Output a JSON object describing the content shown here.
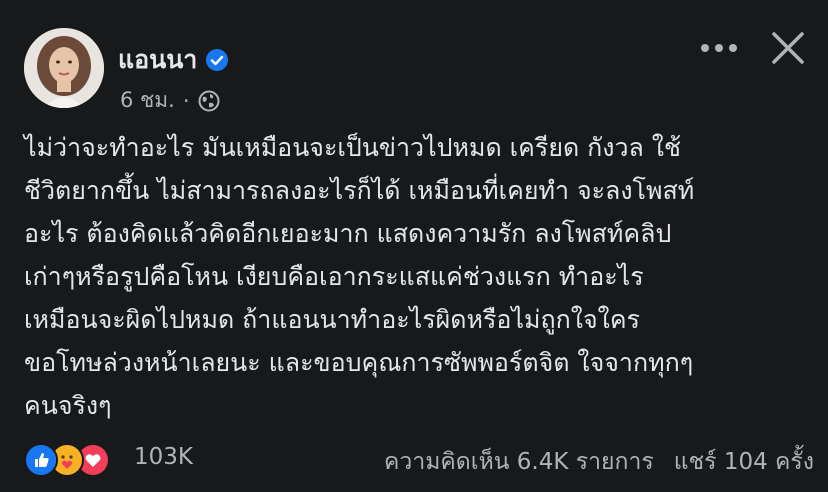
{
  "post": {
    "author": "แอนนา",
    "time": "6 ชม.",
    "separator": "·",
    "body_lines": [
      "ไม่ว่าจะทำอะไร มันเหมือนจะเป็นข่าวไปหมด เครียด กังวล ใช้",
      "ชีวิตยากขึ้น ไม่สามารถลงอะไรก็ได้ เหมือนที่เคยทำ จะลงโพสท์",
      "อะไร ต้องคิดแล้วคิดอีกเยอะมาก แสดงความรัก ลงโพสท์คลิป",
      "เก่าๆหรือรูปคือโหน เงียบคือเอากระแสแค่ช่วงแรก ทำอะไร",
      "เหมือนจะผิดไปหมด ถ้าแอนนาทำอะไรผิดหรือไม่ถูกใจใคร",
      "ขอโทษล่วงหน้าเลยนะ และขอบคุณการซัพพอร์ตจิต ใจจากทุกๆ",
      "คนจริงๆ"
    ],
    "reaction_count": "103K",
    "comments": "ความคิดเห็น 6.4K รายการ",
    "shares": "แชร์ 104 ครั้ง"
  },
  "icons": {
    "verified": "verified-badge-icon",
    "privacy": "globe-icon",
    "more": "more-options-icon",
    "close": "close-icon",
    "reactions": [
      "like-icon",
      "care-icon",
      "love-icon"
    ]
  },
  "colors": {
    "background": "#18191a",
    "text": "#e4e6eb",
    "secondary": "#b0b3b8",
    "like": "#1877f2",
    "love": "#f33e58",
    "care": "#f7b125"
  }
}
